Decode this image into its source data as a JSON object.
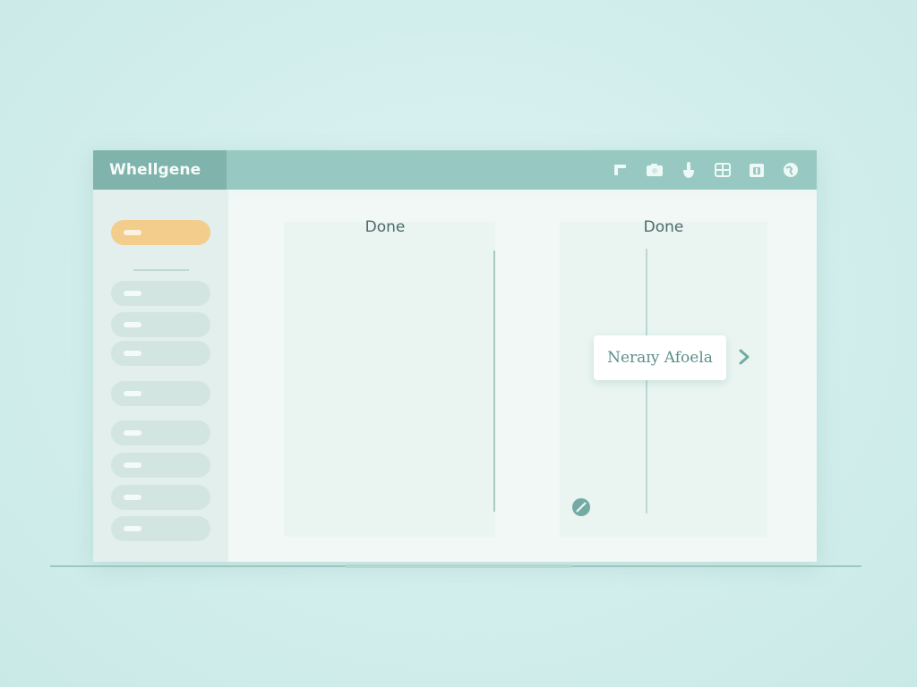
{
  "app": {
    "title": "Whellgene"
  },
  "toolbar": {
    "icons": [
      "flag-icon",
      "camera-icon",
      "pointer-hand-icon",
      "grid-icon",
      "calendar-icon",
      "globe-icon"
    ]
  },
  "sidebar": {
    "active_index": 0,
    "item_count": 9
  },
  "board": {
    "columns": [
      {
        "heading": "Done"
      },
      {
        "heading": "Done"
      }
    ],
    "drag_card": {
      "label": "Neraɪy Afoela"
    }
  },
  "colors": {
    "accent": "#97c9c2",
    "accent_dark": "#7fb3ac",
    "active_item": "#f2cd8c",
    "background": "#d3efed",
    "text_dark": "#4d6a68",
    "card_text": "#5b8f8a"
  }
}
